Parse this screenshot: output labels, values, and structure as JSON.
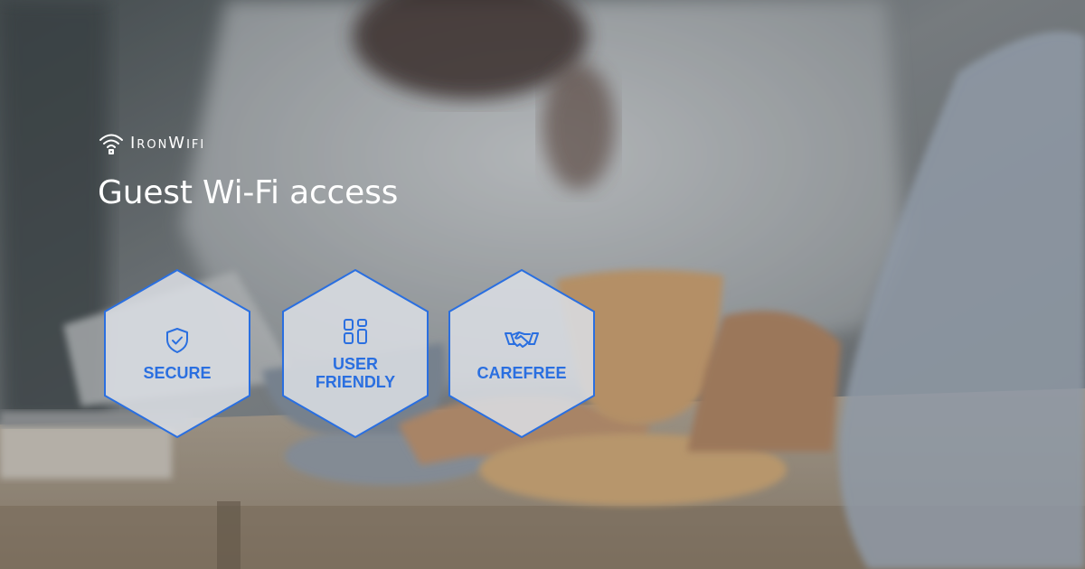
{
  "brand": {
    "name": "IronWifi",
    "logo_icon": "wifi-lock-icon"
  },
  "headline": "Guest Wi-Fi access",
  "features": [
    {
      "label": "SECURE",
      "icon": "shield-check-icon"
    },
    {
      "label": "USER\nFRIENDLY",
      "icon": "grid-apps-icon"
    },
    {
      "label": "CAREFREE",
      "icon": "handshake-icon"
    }
  ],
  "colors": {
    "accent": "#2a6fe0",
    "hex_fill": "#d9dde2",
    "text_light": "#ffffff"
  }
}
